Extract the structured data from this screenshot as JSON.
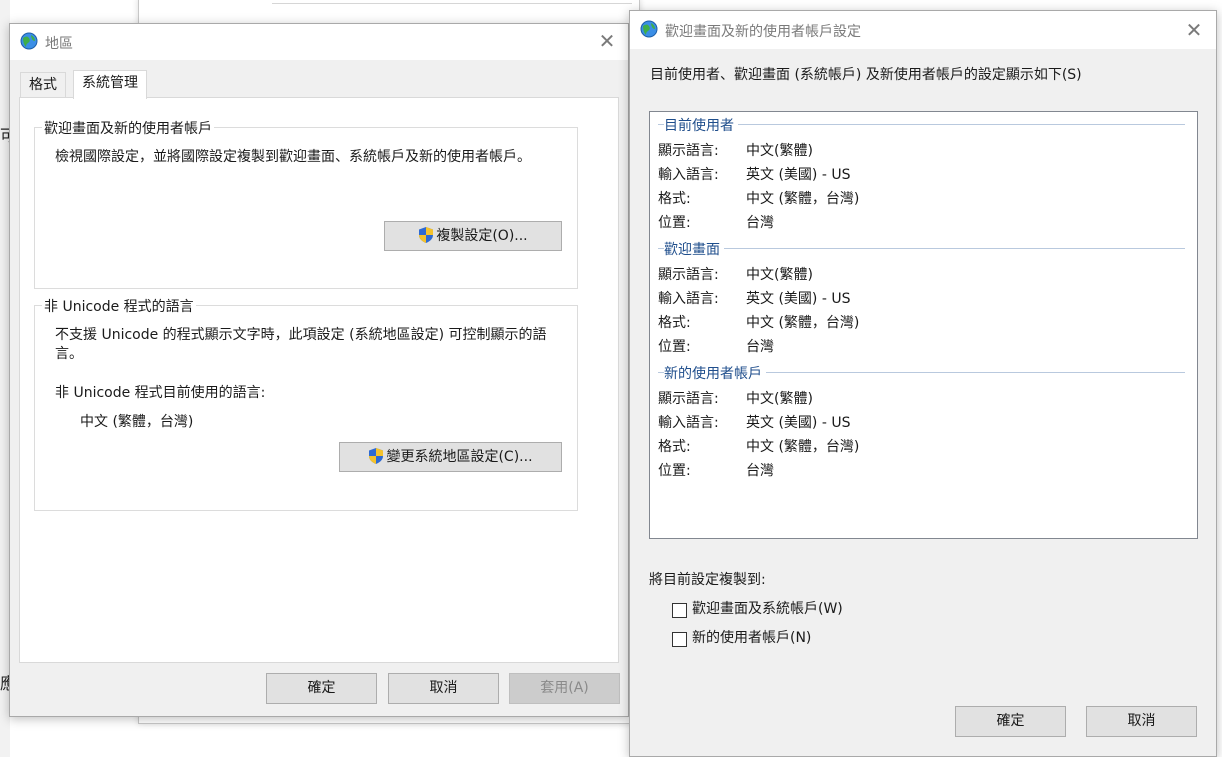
{
  "region_dialog": {
    "title": "地區",
    "tabs": [
      "格式",
      "系統管理"
    ],
    "welcome_group": {
      "legend": "歡迎畫面及新的使用者帳戶",
      "description": "檢視國際設定，並將國際設定複製到歡迎畫面、系統帳戶及新的使用者帳戶。",
      "copy_button": "複製設定(O)..."
    },
    "unicode_group": {
      "legend": "非 Unicode 程式的語言",
      "description": "不支援 Unicode 的程式顯示文字時，此項設定 (系統地區設定) 可控制顯示的語言。",
      "current_label": "非 Unicode 程式目前使用的語言:",
      "current_value": "中文 (繁體，台灣)",
      "change_button": "變更系統地區設定(C)..."
    },
    "ok_button": "確定",
    "cancel_button": "取消",
    "apply_button": "套用(A)"
  },
  "welcome_dialog": {
    "title": "歡迎畫面及新的使用者帳戶設定",
    "intro": "目前使用者、歡迎畫面 (系統帳戶) 及新使用者帳戶的設定顯示如下(S)",
    "sections": [
      {
        "heading": "目前使用者",
        "rows": [
          {
            "key": "顯示語言:",
            "value": "中文(繁體)"
          },
          {
            "key": "輸入語言:",
            "value": "英文 (美國) - US"
          },
          {
            "key": "格式:",
            "value": "中文 (繁體，台灣)"
          },
          {
            "key": "位置:",
            "value": "台灣"
          }
        ]
      },
      {
        "heading": "歡迎畫面",
        "rows": [
          {
            "key": "顯示語言:",
            "value": "中文(繁體)"
          },
          {
            "key": "輸入語言:",
            "value": "英文 (美國) - US"
          },
          {
            "key": "格式:",
            "value": "中文 (繁體，台灣)"
          },
          {
            "key": "位置:",
            "value": "台灣"
          }
        ]
      },
      {
        "heading": "新的使用者帳戶",
        "rows": [
          {
            "key": "顯示語言:",
            "value": "中文(繁體)"
          },
          {
            "key": "輸入語言:",
            "value": "英文 (美國) - US"
          },
          {
            "key": "格式:",
            "value": "中文 (繁體，台灣)"
          },
          {
            "key": "位置:",
            "value": "台灣"
          }
        ]
      }
    ],
    "copy_to_label": "將目前設定複製到:",
    "checkbox_welcome": "歡迎畫面及系統帳戶(W)",
    "checkbox_new_user": "新的使用者帳戶(N)",
    "checkbox_welcome_checked": false,
    "checkbox_new_user_checked": false,
    "ok_button": "確定",
    "cancel_button": "取消"
  },
  "background": {
    "left_fragments": [
      "可",
      "應"
    ]
  },
  "colors": {
    "section_heading": "#1f4e8c",
    "window_bg": "#f0f0f0",
    "title_text": "#7a7a7a"
  },
  "icons": {
    "dialog_icon": "globe-icon",
    "button_icon": "uac-shield-icon",
    "close": "close-icon"
  }
}
